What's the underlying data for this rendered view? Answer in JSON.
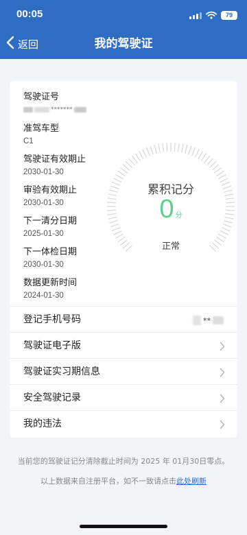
{
  "status_bar": {
    "time": "00:05",
    "battery": "79",
    "icons": [
      "signal-icon",
      "wifi-icon",
      "battery-icon"
    ]
  },
  "nav": {
    "back_label": "返回",
    "title": "我的驾驶证",
    "back_icon": "chevron-left-icon"
  },
  "license_info": [
    {
      "label": "驾驶证号",
      "value": "*******",
      "masked": true
    },
    {
      "label": "准驾车型",
      "value": "C1"
    },
    {
      "label": "驾驶证有效期止",
      "value": "2030-01-30"
    },
    {
      "label": "审验有效期止",
      "value": "2030-01-30"
    },
    {
      "label": "下一清分日期",
      "value": "2025-01-30"
    },
    {
      "label": "下一体检日期",
      "value": "2030-01-30"
    },
    {
      "label": "数据更新时间",
      "value": "2024-01-30"
    }
  ],
  "score": {
    "label": "累积记分",
    "value": 0,
    "unit": "分",
    "status": "正常",
    "max": 12
  },
  "menu": [
    {
      "label": "登记手机号码",
      "value": "**",
      "masked": true,
      "chevron": false
    },
    {
      "label": "驾驶证电子版",
      "chevron": true
    },
    {
      "label": "驾驶证实习期信息",
      "chevron": true
    },
    {
      "label": "安全驾驶记录",
      "chevron": true
    },
    {
      "label": "我的违法",
      "chevron": true
    }
  ],
  "footer": {
    "line1": "当前您的驾驶证记分清除截止时间为 2025 年 01月30日零点。",
    "line2": "以上数据来自注册平台，如不一致请点击",
    "link": "此处刷新"
  },
  "colors": {
    "nav_bg": "#2f6cc3",
    "score_green": "#5fd08c",
    "page_bg": "#f2f4f8",
    "link": "#2f6cc3"
  }
}
